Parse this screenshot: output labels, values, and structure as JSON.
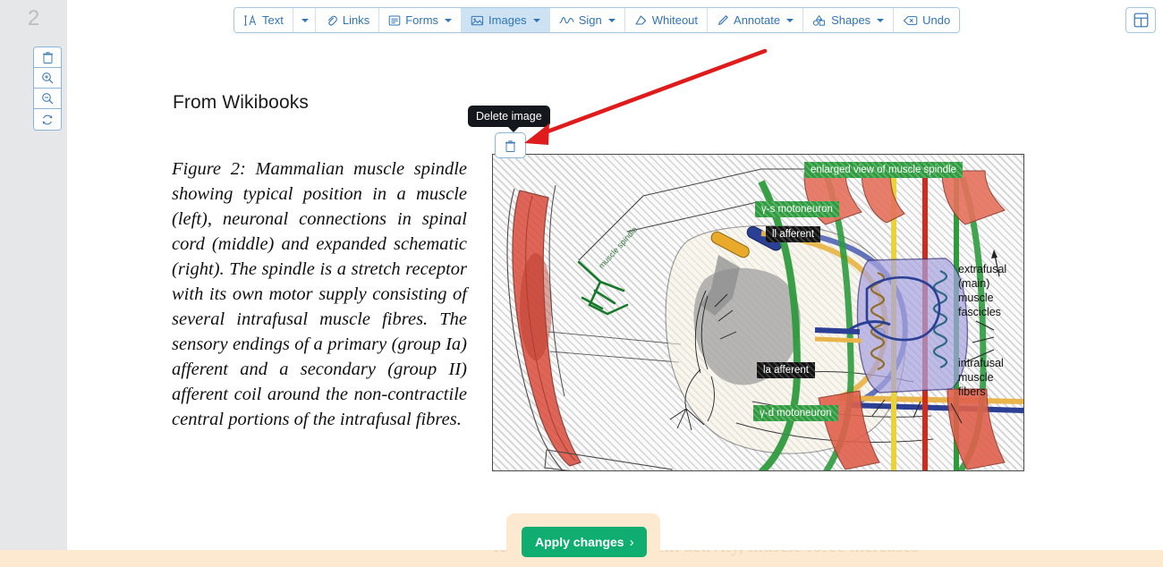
{
  "sidebar": {
    "page_number": "2",
    "tools": [
      {
        "name": "delete-page",
        "icon": "trash-icon"
      },
      {
        "name": "zoom-in",
        "icon": "zoom-in-icon"
      },
      {
        "name": "zoom-out",
        "icon": "zoom-out-icon"
      },
      {
        "name": "rotate",
        "icon": "refresh-icon"
      }
    ]
  },
  "toolbar": {
    "items": [
      {
        "label": "Text",
        "icon": "text-ia-icon",
        "caret": false,
        "active": false
      },
      {
        "label": "",
        "icon": "caret-icon",
        "caret": true,
        "active": false,
        "caret_only": true
      },
      {
        "label": "Links",
        "icon": "link-icon",
        "caret": false,
        "active": false
      },
      {
        "label": "Forms",
        "icon": "forms-icon",
        "caret": true,
        "active": false
      },
      {
        "label": "Images",
        "icon": "image-icon",
        "caret": true,
        "active": true
      },
      {
        "label": "Sign",
        "icon": "signature-icon",
        "caret": true,
        "active": false
      },
      {
        "label": "Whiteout",
        "icon": "eraser-icon",
        "caret": false,
        "active": false
      },
      {
        "label": "Annotate",
        "icon": "pen-icon",
        "caret": true,
        "active": false
      },
      {
        "label": "Shapes",
        "icon": "shapes-icon",
        "caret": true,
        "active": false
      },
      {
        "label": "Undo",
        "icon": "undo-icon",
        "caret": false,
        "active": false
      }
    ]
  },
  "grid_button": {
    "icon": "grid-panel-icon"
  },
  "tooltip": {
    "text": "Delete image"
  },
  "delete_button": {
    "icon": "trash-icon"
  },
  "document": {
    "heading": "From Wikibooks",
    "caption": "Figure 2: Mammalian muscle spindle showing typical position in a muscle (left), neuronal connections in spinal cord (middle) and expanded schematic (right). The spindle is a stretch receptor with its own motor supply consisting of several intrafusal muscle fibres. The sensory endings of a primary (group Ia) afferent and a secondary (group II) afferent coil around the non-contractile central portions of the intrafusal fibres.",
    "bottom_text": "rapidly adapting afferent activity, muscle force increases"
  },
  "figure": {
    "labels": [
      {
        "text": "enlarged view of muscle spindle",
        "style": "green"
      },
      {
        "text": "γ-s motoneuron",
        "style": "green"
      },
      {
        "text": "ll afferent",
        "style": "black"
      },
      {
        "text": "la afferent",
        "style": "black"
      },
      {
        "text": "γ-d motoneuron",
        "style": "green"
      }
    ],
    "plain_labels": [
      {
        "text": "extrafusal\n(main)\nmuscle\nfascicles"
      },
      {
        "text": "intrafusal\nmuscle\nfibers"
      }
    ]
  },
  "apply": {
    "label": "Apply changes",
    "chevron": "›"
  },
  "colors": {
    "accent_blue": "#2f74b5",
    "active_tab": "#cde3f4",
    "apply_green": "#0fae70",
    "panel_cream": "#fce9cf",
    "annotation_red": "#e01b1b",
    "tooltip_black": "#14181c"
  }
}
